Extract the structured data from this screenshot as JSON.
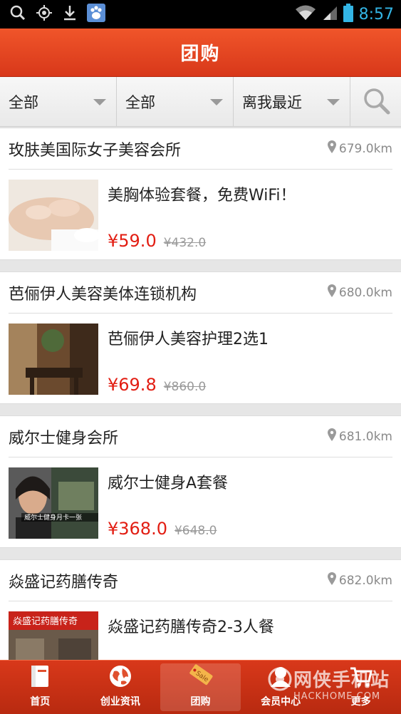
{
  "status_bar": {
    "time": "8:57"
  },
  "header": {
    "title": "团购"
  },
  "filters": [
    {
      "label": "全部"
    },
    {
      "label": "全部"
    },
    {
      "label": "离我最近"
    }
  ],
  "listings": [
    {
      "merchant": "玫肤美国际女子美容会所",
      "distance": "679.0km",
      "deal_title": "美胸体验套餐，免费WiFi！",
      "price": "¥59.0",
      "original_price": "¥432.0"
    },
    {
      "merchant": "芭俪伊人美容美体连锁机构",
      "distance": "680.0km",
      "deal_title": "芭俪伊人美容护理2选1",
      "price": "¥69.8",
      "original_price": "¥860.0"
    },
    {
      "merchant": "威尔士健身会所",
      "distance": "681.0km",
      "deal_title": "威尔士健身A套餐",
      "price": "¥368.0",
      "original_price": "¥648.0",
      "image_caption": "威尔士健身月卡一张"
    },
    {
      "merchant": "焱盛记药膳传奇",
      "distance": "682.0km",
      "deal_title": "焱盛记药膳传奇2-3人餐",
      "image_caption": "焱盛记药膳传奇"
    }
  ],
  "bottom_nav": [
    {
      "label": "首页"
    },
    {
      "label": "创业资讯"
    },
    {
      "label": "团购",
      "active": true
    },
    {
      "label": "会员中心"
    },
    {
      "label": "更多"
    }
  ],
  "watermark": {
    "text_cn": "网侠手机站",
    "text_en": "HACKHOME.COM"
  },
  "colors": {
    "accent": "#e44422",
    "price": "#e21d12",
    "status_time": "#33b5e5"
  }
}
